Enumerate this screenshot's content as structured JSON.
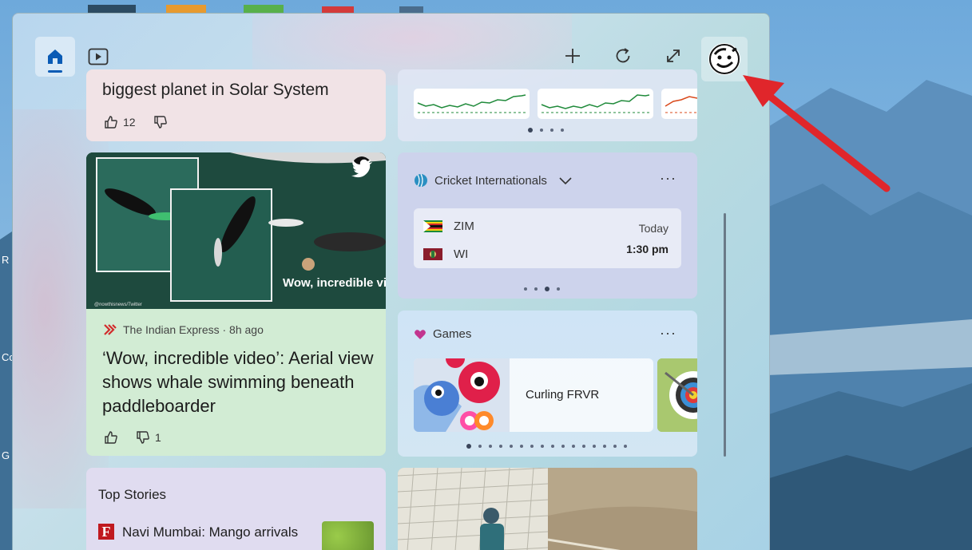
{
  "desktop": {
    "labels": [
      "R",
      "Co",
      "G"
    ]
  },
  "toolbar": {
    "home_tab": "home-icon",
    "video_tab": "video-icon",
    "add_icon": "plus-icon",
    "refresh_icon": "refresh-icon",
    "expand_icon": "expand-icon",
    "avatar_icon": "avatar"
  },
  "cards": {
    "planet": {
      "title": "biggest planet in Solar System",
      "likes": "12"
    },
    "whale": {
      "overlay_text": "Wow, incredible video!!",
      "image_credit": "@nowthisnews/Twitter",
      "source": "The Indian Express · 8h ago",
      "title": "‘Wow, incredible video’: Aerial view shows whale swimming beneath paddleboarder",
      "dislikes": "1"
    },
    "cricket": {
      "header": "Cricket Internationals",
      "team1": "ZIM",
      "team2": "WI",
      "day": "Today",
      "time": "1:30 pm",
      "more": "···"
    },
    "games": {
      "header": "Games",
      "game1": "Curling FRVR",
      "more": "···"
    },
    "stories": {
      "header": "Top Stories",
      "story1": "Navi Mumbai: Mango arrivals",
      "story1_logo": "F"
    }
  },
  "colors": {
    "accent": "#0a5bb5",
    "arrow": "#e0262b",
    "spark_green": "#1f8a3a",
    "spark_red": "#d9481a"
  }
}
